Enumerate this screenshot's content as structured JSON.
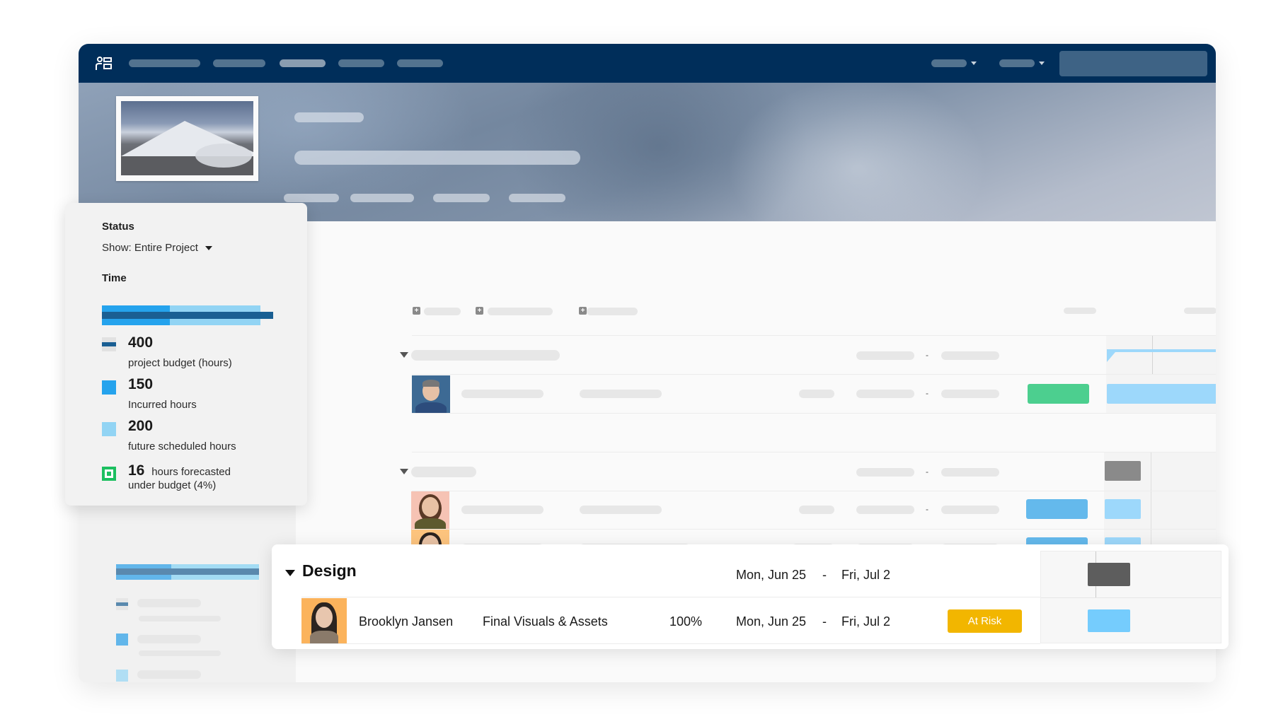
{
  "app": {
    "navbar": {
      "logo_icon": "people-list-icon",
      "nav_items": [
        "",
        "",
        "",
        "",
        ""
      ],
      "dropdowns": [
        "",
        ""
      ],
      "search_placeholder": ""
    },
    "hero": {
      "thumbnail": "mountain-photo",
      "tabs": [
        "",
        "",
        "",
        ""
      ]
    }
  },
  "status_popup": {
    "status_label": "Status",
    "show_label": "Show: Entire Project",
    "time_label": "Time",
    "time_chart": {
      "budget_hours": 400,
      "incurred_hours": 150,
      "future_scheduled_hours": 200
    },
    "legend": [
      {
        "value": "400",
        "description": "project budget (hours)",
        "swatch": "budget-line",
        "color": "#1a5f93"
      },
      {
        "value": "150",
        "description": "Incurred hours",
        "swatch": "incurred",
        "color": "#25a3ed"
      },
      {
        "value": "200",
        "description": "future scheduled hours",
        "swatch": "future",
        "color": "#92d4f4"
      }
    ],
    "forecast": {
      "value": "16",
      "text_inline": "hours forecasted",
      "text_line2": "under budget (4%)",
      "color": "#1cbf60"
    }
  },
  "design_section": {
    "phase_title": "Design",
    "phase_start": "Mon, Jun 25",
    "phase_separator": "-",
    "phase_end": "Fri, Jul 2",
    "task": {
      "assignee": "Brooklyn Jansen",
      "task_name": "Final Visuals & Assets",
      "percent": "100%",
      "start": "Mon, Jun 25",
      "separator": "-",
      "end": "Fri, Jul 2",
      "status": "At Risk",
      "status_color": "#f2b600"
    }
  },
  "background_rows": {
    "separator": "-"
  },
  "colors": {
    "navbar": "#002e5a",
    "on_track": "#4ccf8f",
    "in_progress": "#64b9ec",
    "gantt_bar": "#9dd8fb",
    "gantt_phase": "#8a8a8a",
    "gantt_phase_active": "#5d5d5d",
    "gantt_task_active": "#75ccfd"
  }
}
